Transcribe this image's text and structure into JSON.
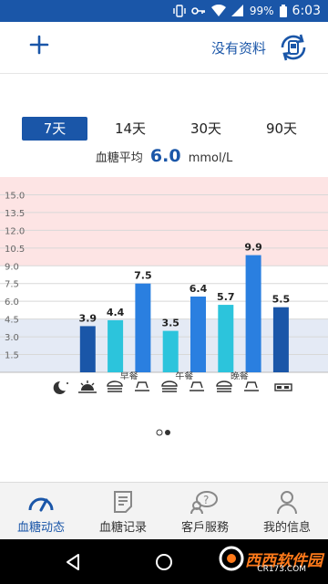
{
  "status": {
    "battery": "99%",
    "time": "6:03"
  },
  "header": {
    "no_data_label": "没有资料"
  },
  "periods": [
    {
      "label": "7天",
      "active": true
    },
    {
      "label": "14天",
      "active": false
    },
    {
      "label": "30天",
      "active": false
    },
    {
      "label": "90天",
      "active": false
    }
  ],
  "average": {
    "label": "血糖平均",
    "value": "6.0",
    "unit": "mmol/L"
  },
  "chart_data": {
    "type": "bar",
    "y_ticks": [
      "15.0",
      "13.5",
      "12.0",
      "10.5",
      "9.0",
      "7.5",
      "6.0",
      "4.5",
      "3.0",
      "1.5"
    ],
    "ylim": [
      0,
      16.5
    ],
    "bands": [
      {
        "from": 9.0,
        "to": 16.5,
        "color": "#fde4e4"
      },
      {
        "from": 0,
        "to": 4.5,
        "color": "#e4eaf5"
      }
    ],
    "slots": [
      "night",
      "wake",
      "breakfast-before",
      "breakfast-after",
      "lunch-before",
      "lunch-after",
      "dinner-before",
      "dinner-after",
      "bed"
    ],
    "bars": [
      {
        "slot": 1,
        "value": 3.9,
        "label": "3.9",
        "color": "#1a56a8"
      },
      {
        "slot": 2,
        "value": 4.4,
        "label": "4.4",
        "color": "#2cc4dc"
      },
      {
        "slot": 3,
        "value": 7.5,
        "label": "7.5",
        "color": "#2a7fe0"
      },
      {
        "slot": 4,
        "value": 3.5,
        "label": "3.5",
        "color": "#2cc4dc"
      },
      {
        "slot": 5,
        "value": 6.4,
        "label": "6.4",
        "color": "#2a7fe0"
      },
      {
        "slot": 6,
        "value": 5.7,
        "label": "5.7",
        "color": "#2cc4dc"
      },
      {
        "slot": 7,
        "value": 9.9,
        "label": "9.9",
        "color": "#2a7fe0"
      },
      {
        "slot": 8,
        "value": 5.5,
        "label": "5.5",
        "color": "#1a56a8"
      }
    ],
    "meal_labels": [
      {
        "label": "早餐",
        "between": [
          2,
          3
        ]
      },
      {
        "label": "午餐",
        "between": [
          4,
          5
        ]
      },
      {
        "label": "晚餐",
        "between": [
          6,
          7
        ]
      }
    ]
  },
  "pager": {
    "pages": 2,
    "current": 2
  },
  "nav": [
    {
      "label": "血糖动态",
      "icon": "gauge-icon",
      "active": true
    },
    {
      "label": "血糖记录",
      "icon": "record-icon",
      "active": false
    },
    {
      "label": "客戶服務",
      "icon": "support-icon",
      "active": false
    },
    {
      "label": "我的信息",
      "icon": "person-icon",
      "active": false
    }
  ],
  "watermark": {
    "brand": "西西软件园",
    "url": "CR173.COM"
  },
  "colors": {
    "accent": "#1a56a8",
    "status_bar": "#1a56a8",
    "high_band": "#fde4e4",
    "low_band": "#e4eaf5"
  }
}
